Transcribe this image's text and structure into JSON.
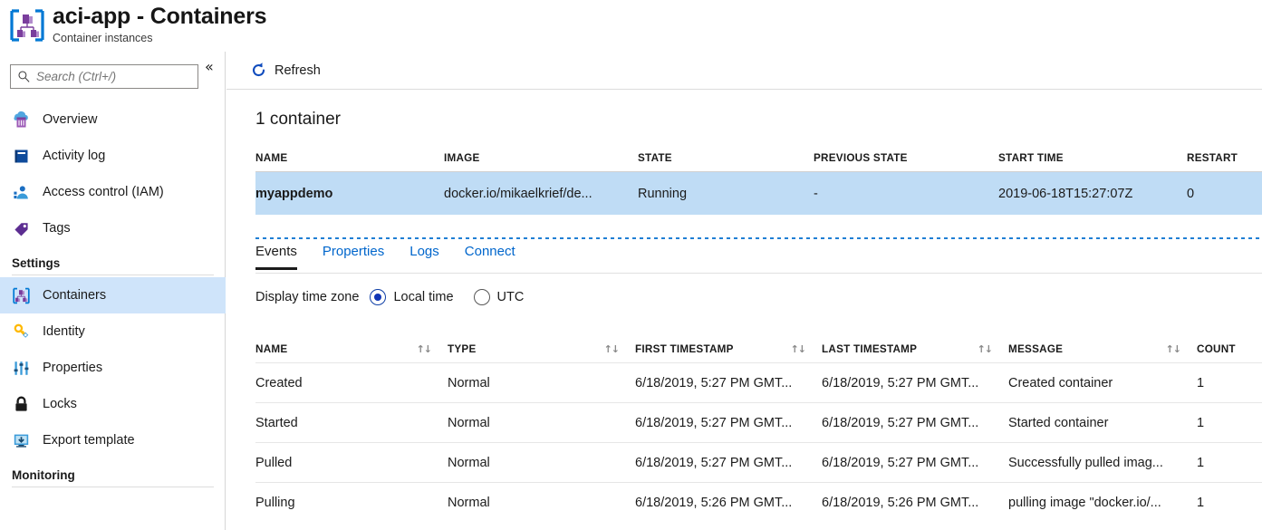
{
  "header": {
    "title": "aci-app - Containers",
    "subtitle": "Container instances",
    "icon": "container-instances-icon"
  },
  "sidebar": {
    "search": {
      "placeholder": "Search (Ctrl+/)",
      "value": "",
      "icon": "search-icon"
    },
    "collapse_icon": "«",
    "items": [
      {
        "label": "Overview",
        "icon": "overview-icon",
        "selected": false
      },
      {
        "label": "Activity log",
        "icon": "activity-log-icon",
        "selected": false
      },
      {
        "label": "Access control (IAM)",
        "icon": "access-control-icon",
        "selected": false
      },
      {
        "label": "Tags",
        "icon": "tags-icon",
        "selected": false
      }
    ],
    "settings_section": "Settings",
    "settings_items": [
      {
        "label": "Containers",
        "icon": "containers-icon",
        "selected": true
      },
      {
        "label": "Identity",
        "icon": "identity-key-icon",
        "selected": false
      },
      {
        "label": "Properties",
        "icon": "properties-sliders-icon",
        "selected": false
      },
      {
        "label": "Locks",
        "icon": "lock-icon",
        "selected": false
      },
      {
        "label": "Export template",
        "icon": "export-template-icon",
        "selected": false
      }
    ],
    "monitoring_section": "Monitoring"
  },
  "toolbar": {
    "refresh_label": "Refresh",
    "refresh_icon": "refresh-icon"
  },
  "containers": {
    "count_label": "1 container",
    "columns": [
      "NAME",
      "IMAGE",
      "STATE",
      "PREVIOUS STATE",
      "START TIME",
      "RESTART"
    ],
    "rows": [
      {
        "name": "myappdemo",
        "image": "docker.io/mikaelkrief/de...",
        "state": "Running",
        "previous_state": "-",
        "start_time": "2019-06-18T15:27:07Z",
        "restart": "0",
        "selected": true
      }
    ]
  },
  "tabs": [
    {
      "label": "Events",
      "active": true
    },
    {
      "label": "Properties",
      "active": false
    },
    {
      "label": "Logs",
      "active": false
    },
    {
      "label": "Connect",
      "active": false
    }
  ],
  "timezone": {
    "label": "Display time zone",
    "options": [
      {
        "label": "Local time",
        "checked": true
      },
      {
        "label": "UTC",
        "checked": false
      }
    ]
  },
  "events": {
    "columns": [
      "NAME",
      "TYPE",
      "FIRST TIMESTAMP",
      "LAST TIMESTAMP",
      "MESSAGE",
      "COUNT"
    ],
    "sort_icon": "↑↓",
    "rows": [
      {
        "name": "Created",
        "type": "Normal",
        "first_timestamp": "6/18/2019, 5:27 PM GMT...",
        "last_timestamp": "6/18/2019, 5:27 PM GMT...",
        "message": "Created container",
        "count": "1"
      },
      {
        "name": "Started",
        "type": "Normal",
        "first_timestamp": "6/18/2019, 5:27 PM GMT...",
        "last_timestamp": "6/18/2019, 5:27 PM GMT...",
        "message": "Started container",
        "count": "1"
      },
      {
        "name": "Pulled",
        "type": "Normal",
        "first_timestamp": "6/18/2019, 5:27 PM GMT...",
        "last_timestamp": "6/18/2019, 5:27 PM GMT...",
        "message": "Successfully pulled imag...",
        "count": "1"
      },
      {
        "name": "Pulling",
        "type": "Normal",
        "first_timestamp": "6/18/2019, 5:26 PM GMT...",
        "last_timestamp": "6/18/2019, 5:26 PM GMT...",
        "message": "pulling image \"docker.io/...",
        "count": "1"
      }
    ]
  },
  "colors": {
    "accent_blue": "#0066cc",
    "selected_row": "#bfdcf5",
    "sidebar_selected": "#cfe4fa",
    "dotted_rule": "#1f7fd4"
  }
}
